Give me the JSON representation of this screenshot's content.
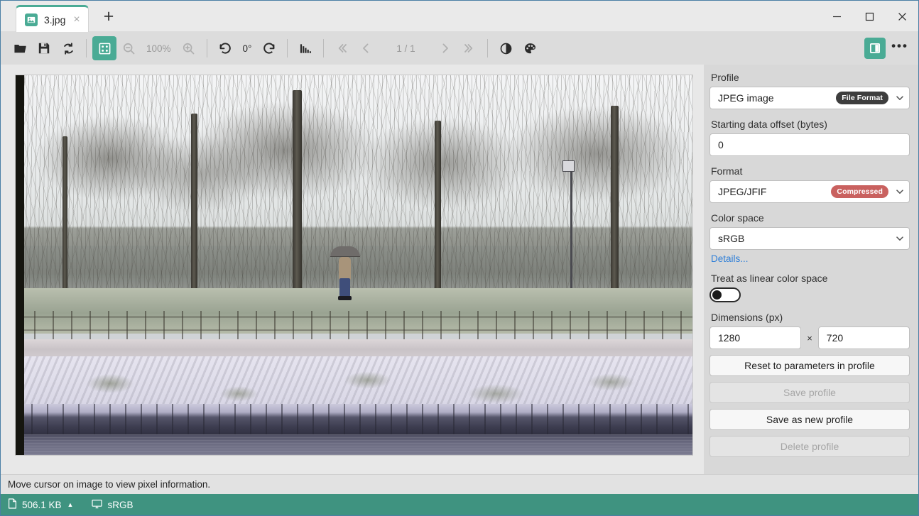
{
  "window": {
    "tab": {
      "label": "3.jpg",
      "icon": "image-icon",
      "close": "×"
    },
    "new_tab": "+",
    "controls": {
      "minimize": "—",
      "maximize": "□",
      "close": "✕"
    }
  },
  "toolbar": {
    "open_label": "open-file",
    "save_label": "save-file",
    "reload_label": "reload",
    "fit_label": "fit-to-window",
    "zoom_out_label": "zoom-out",
    "zoom_level": "100%",
    "zoom_in_label": "zoom-in",
    "rotate_left_label": "rotate-left",
    "rotation": "0°",
    "rotate_right_label": "rotate-right",
    "histogram_label": "histogram",
    "first_label": "«",
    "prev_label": "‹",
    "page_indicator": "1 / 1",
    "next_label": "›",
    "last_label": "»",
    "contrast_label": "brightness-contrast",
    "palette_label": "color-palette",
    "sidebar_toggle_label": "toggle-sidebar",
    "overflow_label": "•••"
  },
  "panel": {
    "profile": {
      "label": "Profile",
      "value": "JPEG image",
      "badge": "File Format",
      "badge_color": "#3d3d3d"
    },
    "offset": {
      "label": "Starting data offset (bytes)",
      "value": "0"
    },
    "format": {
      "label": "Format",
      "value": "JPEG/JFIF",
      "badge": "Compressed",
      "badge_color": "#c9615f"
    },
    "colorspace": {
      "label": "Color space",
      "value": "sRGB",
      "details_link": "Details..."
    },
    "linear": {
      "label": "Treat as linear color space",
      "state": "off"
    },
    "dimensions": {
      "label": "Dimensions (px)",
      "width": "1280",
      "separator": "×",
      "height": "720"
    },
    "buttons": [
      {
        "label": "Reset to parameters in profile",
        "disabled": false
      },
      {
        "label": "Save profile",
        "disabled": true
      },
      {
        "label": "Save as new profile",
        "disabled": false
      },
      {
        "label": "Delete profile",
        "disabled": true
      }
    ]
  },
  "status": {
    "hint": "Move cursor on image to view pixel information.",
    "file_size": "506.1 KB",
    "size_caret": "▲",
    "color_profile": "sRGB"
  },
  "theme": {
    "accent": "#4aab95",
    "statusbar": "#3f9380",
    "link": "#2f7fd8"
  },
  "image": {
    "alt": "Winter park scene with bare trees, a person holding an umbrella walking on a snowy path, stone wall and water"
  }
}
